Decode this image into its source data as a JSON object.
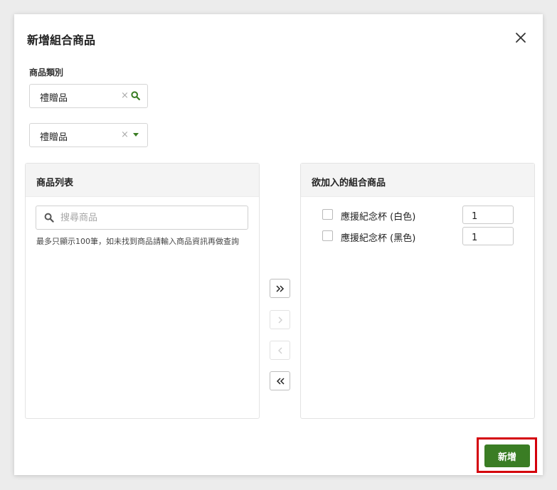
{
  "modal": {
    "title": "新增組合商品",
    "category_label": "商品類別",
    "category_select": {
      "value": "禮贈品",
      "clear": "×"
    },
    "subcategory_select": {
      "value": "禮贈品",
      "clear": "×"
    }
  },
  "left_panel": {
    "title": "商品列表",
    "search_placeholder": "搜尋商品",
    "hint": "最多只顯示100筆，如未找到商品請輸入商品資訊再做查詢"
  },
  "transfer_buttons": {
    "move_all_right": "»",
    "move_right": "›",
    "move_left": "‹",
    "move_all_left": "«"
  },
  "right_panel": {
    "title": "欲加入的組合商品",
    "items": [
      {
        "name": "應援紀念杯 (白色)",
        "qty": "1"
      },
      {
        "name": "應援紀念杯 (黑色)",
        "qty": "1"
      }
    ]
  },
  "footer": {
    "add_button": "新增"
  },
  "colors": {
    "primary": "#3a7d24",
    "highlight": "#d4000b"
  }
}
